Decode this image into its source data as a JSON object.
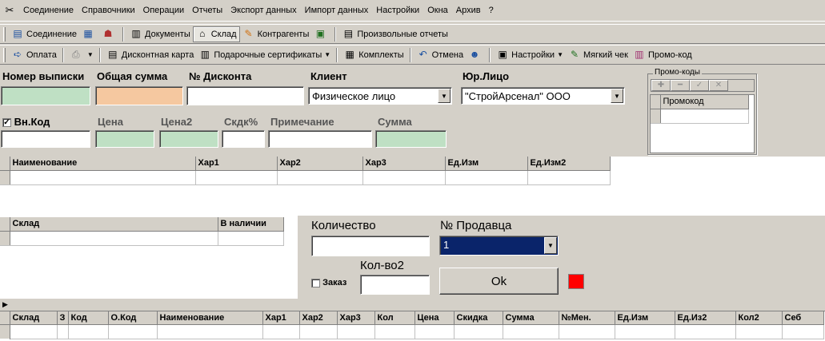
{
  "menu": [
    "Соединение",
    "Справочники",
    "Операции",
    "Отчеты",
    "Экспорт данных",
    "Импорт данных",
    "Настройки",
    "Окна",
    "Архив",
    "?"
  ],
  "toolbar1": {
    "connect": "Соединение",
    "documents": "Документы",
    "warehouse": "Склад",
    "contractors": "Контрагенты",
    "custom_reports": "Произвольные отчеты"
  },
  "toolbar2": {
    "payment": "Оплата",
    "discount_card": "Дисконтная карта",
    "gift_certificates": "Подарочные сертификаты",
    "sets": "Комплекты",
    "cancel": "Отмена",
    "settings": "Настройки",
    "soft_check": "Мягкий чек",
    "promo_code": "Промо-код"
  },
  "form": {
    "labels": {
      "statement_no": "Номер выписки",
      "total_sum": "Общая сумма",
      "discount_no": "№ Дисконта",
      "client": "Клиент",
      "legal_entity": "Юр.Лицо",
      "inner_code": "Вн.Код",
      "price": "Цена",
      "price2": "Цена2",
      "discount_pct": "Скдк%",
      "note": "Примечание",
      "sum": "Сумма",
      "quantity": "Количество",
      "seller_no": "№ Продавца",
      "qty2": "Кол-во2",
      "order": "Заказ"
    },
    "client_value": "Физическое лицо",
    "legal_value": "\"СтройАрсенал\"  ООО",
    "seller_value": "1",
    "ok_label": "Ok"
  },
  "promo": {
    "title": "Промо-коды",
    "column": "Промокод"
  },
  "goods_columns": [
    "Наименование",
    "Хар1",
    "Хар2",
    "Хар3",
    "Ед.Изм",
    "Ед.Изм2"
  ],
  "stock_columns": [
    "Склад",
    "В наличии"
  ],
  "doc_columns": [
    "Склад",
    "З",
    "Код",
    "О.Код",
    "Наименование",
    "Хар1",
    "Хар2",
    "Хар3",
    "Кол",
    "Цена",
    "Скидка",
    "Сумма",
    "№Мен.",
    "Ед.Изм",
    "Ед.Из2",
    "Кол2",
    "Себ"
  ],
  "colors": {
    "status_indicator": "#ff0000",
    "selected": "#0a246a"
  }
}
